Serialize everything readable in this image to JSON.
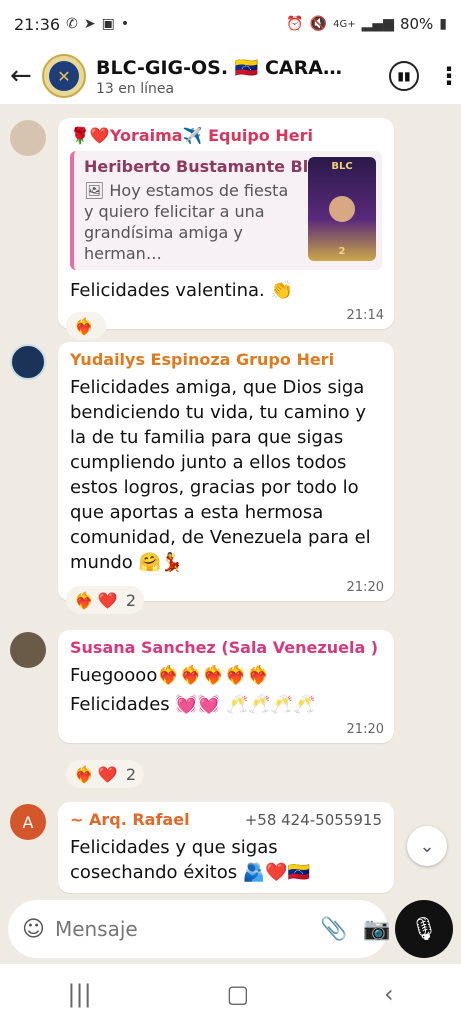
{
  "status": {
    "time": "21:36",
    "battery": "80%",
    "network": "4G+"
  },
  "header": {
    "title": "BLC-GIG-OS. 🇻🇪 CARACAS 🇻🇪",
    "subtitle": "13 en línea"
  },
  "messages": [
    {
      "sender": "🌹❤️Yoraima✈️ Equipo Heri",
      "quote_name": "Heriberto Bustamante Blc",
      "quote_text": "🖼 Hoy estamos de fiesta y quiero felicitar a una grandísima amiga y herman…",
      "quote_thumb_label": "BLC",
      "text": "Felicidades valentina. 👏",
      "time": "21:14",
      "reactions": [
        "❤️‍🔥"
      ],
      "reaction_count": ""
    },
    {
      "sender": "Yudailys Espinoza Grupo Heri",
      "text": "Felicidades amiga, que Dios siga bendiciendo tu vida, tu camino y la de tu familia para que sigas cumpliendo junto a ellos todos estos logros, gracias por todo lo que aportas a esta hermosa comunidad, de Venezuela para el mundo 🤗💃",
      "time": "21:20",
      "reactions": [
        "❤️‍🔥",
        "❤️"
      ],
      "reaction_count": "2"
    },
    {
      "sender": "Susana Sanchez (Sala Venezuela )",
      "text_line1": "Fuegoooo❤️‍🔥❤️‍🔥❤️‍🔥❤️‍🔥❤️‍🔥",
      "text_line2": "Felicidades 💓💓 🥂🥂🥂🥂",
      "time": "21:20",
      "reactions": [
        "❤️‍🔥",
        "❤️"
      ],
      "reaction_count": "2"
    },
    {
      "sender": "~ Arq. Rafael",
      "avatar_letter": "A",
      "phone": "+58 424-5055915",
      "text": "Felicidades y que sigas cosechando éxitos 🫂❤️🇻🇪"
    }
  ],
  "input": {
    "placeholder": "Mensaje"
  },
  "colors": {
    "yoraima": "#d9365e",
    "yudailys": "#e07a1f",
    "susana": "#d63a7e",
    "rafael": "#e06a2a"
  }
}
